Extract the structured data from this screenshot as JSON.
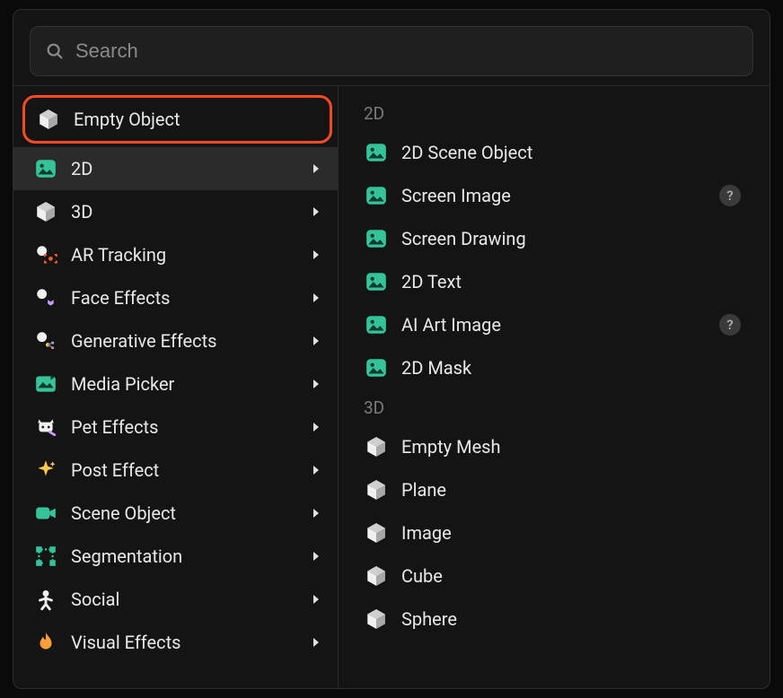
{
  "search": {
    "placeholder": "Search"
  },
  "categories": [
    {
      "id": "empty-object",
      "label": "Empty Object",
      "icon": "cube-white",
      "has_submenu": false,
      "highlighted": true
    },
    {
      "id": "2d",
      "label": "2D",
      "icon": "image-green",
      "has_submenu": true,
      "selected": true
    },
    {
      "id": "3d",
      "label": "3D",
      "icon": "cube-white",
      "has_submenu": true
    },
    {
      "id": "ar-tracking",
      "label": "AR Tracking",
      "icon": "ar-tracking",
      "has_submenu": true
    },
    {
      "id": "face-effects",
      "label": "Face Effects",
      "icon": "face-effects",
      "has_submenu": true
    },
    {
      "id": "generative-effects",
      "label": "Generative Effects",
      "icon": "generative",
      "has_submenu": true
    },
    {
      "id": "media-picker",
      "label": "Media Picker",
      "icon": "media-picker",
      "has_submenu": true
    },
    {
      "id": "pet-effects",
      "label": "Pet Effects",
      "icon": "pet",
      "has_submenu": true
    },
    {
      "id": "post-effect",
      "label": "Post Effect",
      "icon": "sparkle",
      "has_submenu": true
    },
    {
      "id": "scene-object",
      "label": "Scene Object",
      "icon": "camera",
      "has_submenu": true
    },
    {
      "id": "segmentation",
      "label": "Segmentation",
      "icon": "segmentation",
      "has_submenu": true
    },
    {
      "id": "social",
      "label": "Social",
      "icon": "person",
      "has_submenu": true
    },
    {
      "id": "visual-effects",
      "label": "Visual Effects",
      "icon": "flame",
      "has_submenu": true
    }
  ],
  "right_sections": [
    {
      "header": "2D",
      "items": [
        {
          "id": "2d-scene-object",
          "label": "2D Scene Object",
          "icon": "image-green"
        },
        {
          "id": "screen-image",
          "label": "Screen Image",
          "icon": "image-green",
          "help": true
        },
        {
          "id": "screen-drawing",
          "label": "Screen Drawing",
          "icon": "image-green"
        },
        {
          "id": "2d-text",
          "label": "2D Text",
          "icon": "image-green"
        },
        {
          "id": "ai-art-image",
          "label": "AI Art Image",
          "icon": "image-green",
          "help": true
        },
        {
          "id": "2d-mask",
          "label": "2D Mask",
          "icon": "image-green"
        }
      ]
    },
    {
      "header": "3D",
      "items": [
        {
          "id": "empty-mesh",
          "label": "Empty Mesh",
          "icon": "cube-white"
        },
        {
          "id": "plane",
          "label": "Plane",
          "icon": "cube-white"
        },
        {
          "id": "image-3d",
          "label": "Image",
          "icon": "cube-white"
        },
        {
          "id": "cube",
          "label": "Cube",
          "icon": "cube-white"
        },
        {
          "id": "sphere",
          "label": "Sphere",
          "icon": "cube-white"
        }
      ]
    }
  ]
}
